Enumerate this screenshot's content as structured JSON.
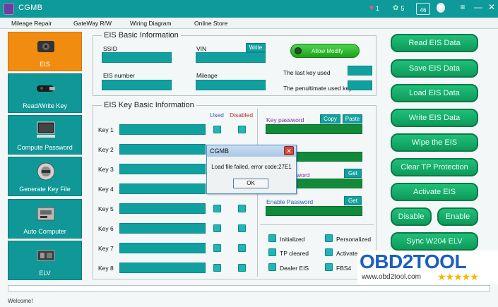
{
  "app": {
    "title": "CGMB",
    "hearts_count": "1",
    "leaves_count": "5",
    "battery_level": "46",
    "minimize_glyph": "≡",
    "close_glyph": "✕"
  },
  "menu": [
    "Mileage Repair",
    "GateWay R/W",
    "Wiring Diagram",
    "Online Store"
  ],
  "nav": [
    {
      "label": "EIS",
      "icon": "eis-key-icon",
      "active": true
    },
    {
      "label": "Read/Write Key",
      "icon": "car-key-icon",
      "active": false
    },
    {
      "label": "Compute Password",
      "icon": "computer-icon",
      "active": false
    },
    {
      "label": "Generate Key File",
      "icon": "steering-lock-icon",
      "active": false
    },
    {
      "label": "Auto Computer",
      "icon": "ecu-icon",
      "active": false
    },
    {
      "label": "ELV",
      "icon": "elv-module-icon",
      "active": false
    }
  ],
  "eis_basic": {
    "title": "EIS Basic Information",
    "ssid_label": "SSID",
    "vin_label": "VIN",
    "write_button": "Write",
    "allow_modify": "Allow Modify",
    "eis_number_label": "EIS number",
    "mileage_label": "Mileage",
    "last_key_used": "The last key used",
    "penultimate_key_used": "The penultimate used key"
  },
  "eis_key": {
    "title": "EIS Key Basic Information",
    "used_header": "Used",
    "disabled_header": "Disabled",
    "keys": [
      "Key 1",
      "Key 2",
      "Key 3",
      "Key 4",
      "Key 5",
      "Key 6",
      "Key 7",
      "Key 8"
    ],
    "key_password_label": "Key password",
    "copy_button": "Copy",
    "paste_button": "Paste",
    "password_label_partial": "word",
    "get_button": "Get",
    "enable_password_label": "Enable Password",
    "status_items": [
      "Initialized",
      "Personalized",
      "TP cleared",
      "Activate",
      "Dealer EIS",
      "FBS4"
    ]
  },
  "actions": [
    "Read  EIS Data",
    "Save EIS Data",
    "Load EIS Data",
    "Write EIS Data",
    "Wipe the EIS",
    "Clear TP Protection",
    "Activate EIS",
    "Disable",
    "Enable",
    "Sync W204 ELV"
  ],
  "dialog": {
    "title": "CGMB",
    "message": "Load file failed, error code:27E1",
    "ok": "OK",
    "close_glyph": "✕"
  },
  "status": {
    "text": "Welcome!"
  },
  "watermark": {
    "logo": "OBD2TOOL",
    "url": "www.obd2tool.com",
    "stars": "★★★★★"
  },
  "colors": {
    "titlebar": "#0e9a9a",
    "nav_active": "#f08c10",
    "field_teal": "#11a0a0",
    "field_green": "#118a3a",
    "action_green": "#0e9a5a"
  }
}
